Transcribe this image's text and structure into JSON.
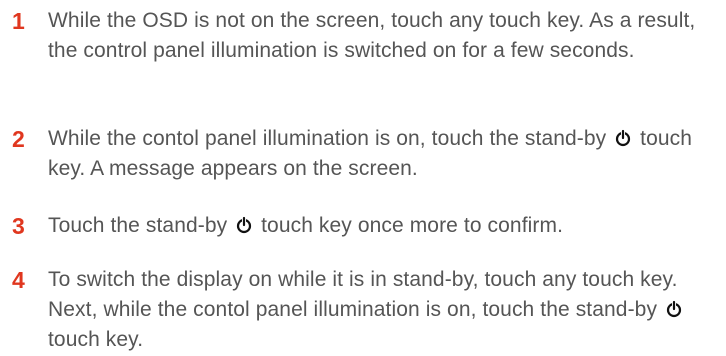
{
  "steps": [
    {
      "number": "1",
      "text": "While the OSD is not on the screen, touch any touch key. As a result, the control panel illumination is switched on for a few seconds."
    },
    {
      "number": "2",
      "text_before_icon": "While the contol panel illumination is on, touch the stand-by",
      "icon": "power-standby-icon",
      "text_after_icon": "touch key. A message appears on the screen."
    },
    {
      "number": "3",
      "text_before_icon": "Touch the stand-by",
      "icon": "power-standby-icon",
      "text_after_icon": "touch key once more to confirm."
    },
    {
      "number": "4",
      "text_before_icon": "To switch the display on while it is in stand-by, touch any touch key. Next, while the contol panel illumination is on, touch the stand-by",
      "icon": "power-standby-icon",
      "text_after_icon": "touch key."
    }
  ],
  "colors": {
    "step_number": "#e0371f",
    "body_text": "#555555"
  }
}
